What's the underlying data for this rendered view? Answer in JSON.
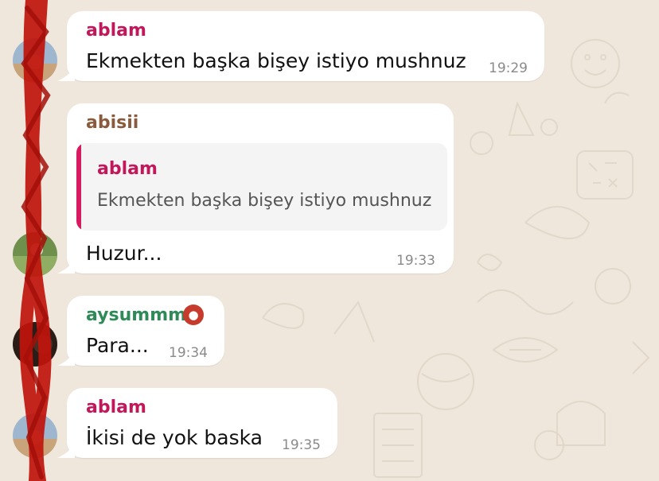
{
  "colors": {
    "wallpaper": "#efe7dc",
    "sender_ablam": "#c2185b",
    "sender_abisii": "#8b5a3c",
    "sender_aysummm": "#2e8b57",
    "quote_bar": "#d81b60",
    "redaction": "#c0140c"
  },
  "messages": [
    {
      "sender": "ablam",
      "text": "Ekmekten başka bişey istiyo mushnuz",
      "time": "19:29"
    },
    {
      "sender": "abisii",
      "reply_to": {
        "sender": "ablam",
        "text": "Ekmekten başka bişey istiyo mushnuz"
      },
      "text": "Huzur...",
      "time": "19:33"
    },
    {
      "sender": "aysummm",
      "sender_badge_icon": "ogre-emoji-icon",
      "text": "Para...",
      "time": "19:34"
    },
    {
      "sender": "ablam",
      "text": "İkisi de yok baska",
      "time": "19:35"
    }
  ]
}
